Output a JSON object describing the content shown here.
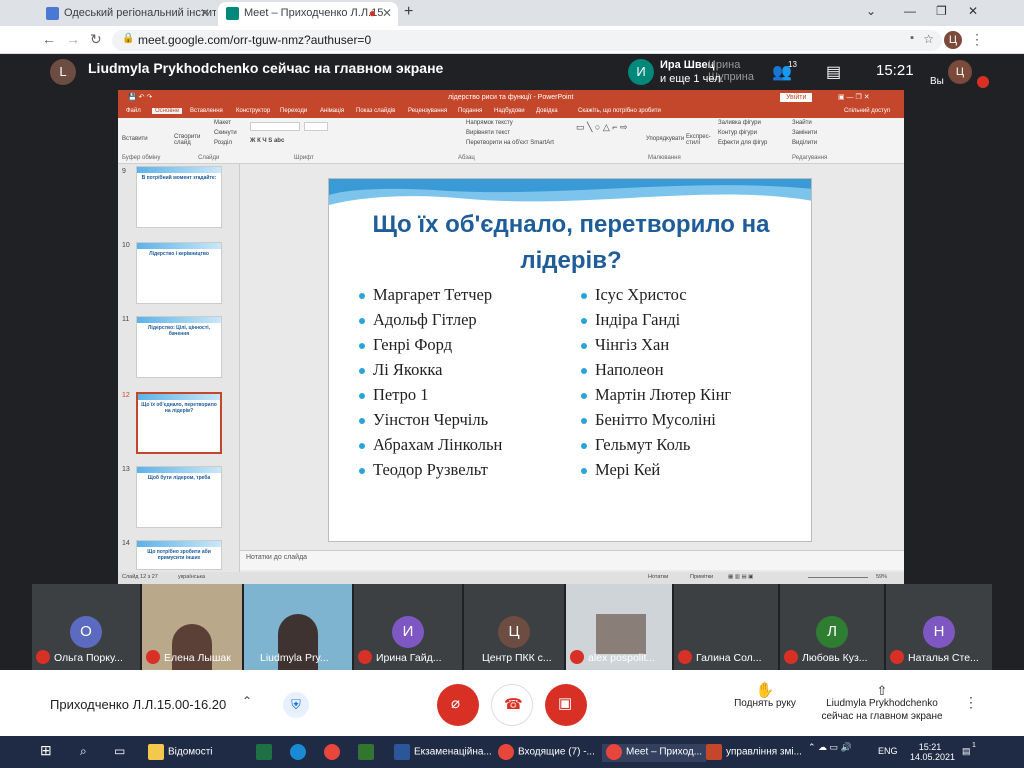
{
  "browser": {
    "tabs": [
      {
        "title": "Одеський регіональний інститут",
        "active": false
      },
      {
        "title": "Meet – Приходченко Л.Л.15",
        "active": true
      }
    ],
    "new_tab": "+",
    "url": "meet.google.com/orr-tguw-nmz?authuser=0",
    "profile_initial": "Ц"
  },
  "meet": {
    "presenter_initial": "L",
    "presenter_text": "Liudmyla Prykhodchenko сейчас на главном экране",
    "speaker_initial": "И",
    "speaker_name": "Ира Швец",
    "speaker_extra": "и еще 1 чел.",
    "speaker_overlay": "Ирина Шуприна",
    "participants_count": "13",
    "time": "15:21",
    "self_label": "Вы",
    "self_initial": "Ц"
  },
  "powerpoint": {
    "title": "лідерство риси та функції - PowerPoint",
    "login": "Увійти",
    "tabs": [
      "Файл",
      "Основне",
      "Вставлення",
      "Конструктор",
      "Переходи",
      "Анімація",
      "Показ слайдів",
      "Рецензування",
      "Подання",
      "Надбудови",
      "Довідка",
      "Скажіть, що потрібно зробити",
      "Спільний доступ"
    ],
    "ribbon_groups": [
      "Буфер обміну",
      "Слайди",
      "Шрифт",
      "Абзац",
      "Малювання",
      "Редагування"
    ],
    "ribbon_items": [
      "Вставити",
      "Створити слайд",
      "Макет",
      "Скинути",
      "Розділ",
      "Напрямок тексту",
      "Вирівняти текст",
      "Перетворити на об'єкт SmartArt",
      "Упорядкувати",
      "Експрес-стилі",
      "Заливка фігури",
      "Контур фігури",
      "Ефекти для фігур",
      "Знайти",
      "Замінити",
      "Виділити"
    ],
    "slide_title": "Що їх об'єднало, перетворило на лідерів?",
    "left_column": [
      "Маргарет Тетчер",
      "Адольф Гітлер",
      "Генрі Форд",
      "Лі Якокка",
      "Петро 1",
      "Уінстон Черчіль",
      "Абрахам Лінкольн",
      "Теодор Рузвельт"
    ],
    "right_column": [
      "Ісус Христос",
      "Індіра Ганді",
      "Чінгіз Хан",
      "Наполеон",
      "Мартін Лютер Кінг",
      "Бенітто Мусоліні",
      "Гельмут Коль",
      "Мері Кей"
    ],
    "thumbnails": [
      {
        "num": "9",
        "title": "В потрібний момент згадайте:"
      },
      {
        "num": "10",
        "title": "Лідерство і керівництво"
      },
      {
        "num": "11",
        "title": "Лідерство: Цілі, цінності, бачення"
      },
      {
        "num": "12",
        "title": "Що їх об'єднало, перетворило на лідерів?"
      },
      {
        "num": "13",
        "title": "Щоб бути лідером, треба"
      },
      {
        "num": "14",
        "title": "Що потрібно зробити аби примусити інших"
      }
    ],
    "notes": "Нотатки до слайда",
    "status_slide": "Слайд 12 з 27",
    "status_lang": "українська",
    "status_notes": "Нотатки",
    "status_comments": "Примітки",
    "zoom": "59%"
  },
  "participants": [
    {
      "initial": "О",
      "name": "Ольга Порку...",
      "color": "#5c6bc0"
    },
    {
      "initial": "",
      "name": "Елена Лышак",
      "color": ""
    },
    {
      "initial": "",
      "name": "Liudmyla Pry...",
      "color": ""
    },
    {
      "initial": "И",
      "name": "Ирина Гайд...",
      "color": "#7e57c2"
    },
    {
      "initial": "Ц",
      "name": "Центр ПКК с...",
      "color": "#6d4c41"
    },
    {
      "initial": "",
      "name": "alex pospolit...",
      "color": ""
    },
    {
      "initial": "",
      "name": "Галина Сол...",
      "color": ""
    },
    {
      "initial": "Л",
      "name": "Любовь Куз...",
      "color": "#2e7d32"
    },
    {
      "initial": "Н",
      "name": "Наталья Сте...",
      "color": "#7e57c2"
    }
  ],
  "bottom": {
    "meeting_name": "Приходченко Л.Л.15.00-16.20",
    "raise_hand": "Поднять руку",
    "presenting": "Liudmyla Prykhodchenko сейчас на главном экране"
  },
  "taskbar": {
    "items": [
      "Відомості",
      "",
      "",
      "",
      "",
      "Екзаменаційна...",
      "Входящие (7) -...",
      "Meet – Приход...",
      "управління змі..."
    ],
    "lang": "ENG",
    "time": "15:21",
    "date": "14.05.2021",
    "notif": "1"
  }
}
